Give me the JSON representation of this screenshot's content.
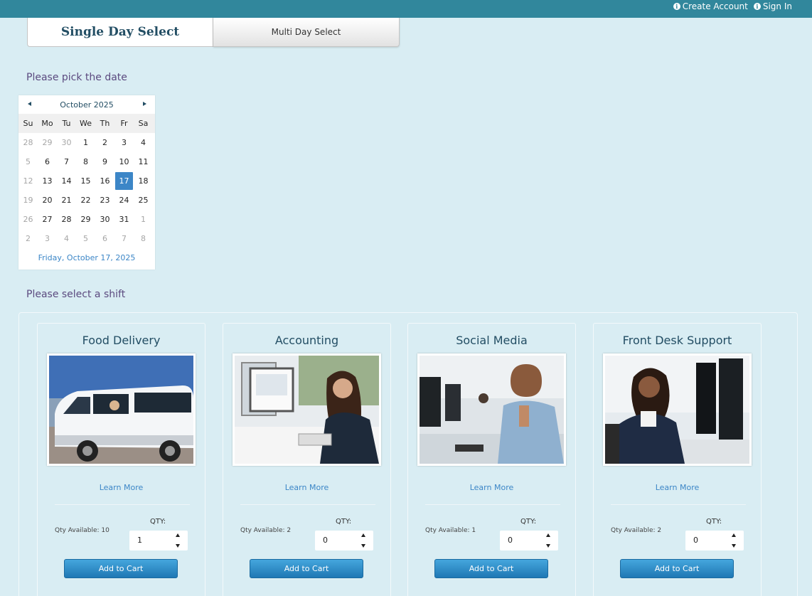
{
  "header": {
    "create_account": "Create Account",
    "sign_in": "Sign In"
  },
  "tabs": {
    "single": "Single Day Select",
    "multi": "Multi Day Select"
  },
  "date_label": "Please pick the date",
  "calendar": {
    "month": "October 2025",
    "dows": [
      "Su",
      "Mo",
      "Tu",
      "We",
      "Th",
      "Fr",
      "Sa"
    ],
    "days": [
      "28",
      "29",
      "30",
      "1",
      "2",
      "3",
      "4",
      "5",
      "6",
      "7",
      "8",
      "9",
      "10",
      "11",
      "12",
      "13",
      "14",
      "15",
      "16",
      "17",
      "18",
      "19",
      "20",
      "21",
      "22",
      "23",
      "24",
      "25",
      "26",
      "27",
      "28",
      "29",
      "30",
      "31",
      "1",
      "2",
      "3",
      "4",
      "5",
      "6",
      "7",
      "8"
    ],
    "muted_indexes": [
      0,
      1,
      2,
      7,
      14,
      21,
      28,
      34,
      35,
      36,
      37,
      38,
      39,
      40,
      41
    ],
    "selected_index": 19,
    "selected_text": "Friday, October 17, 2025"
  },
  "shift_label": "Please select a shift",
  "shifts": [
    {
      "title": "Food Delivery",
      "learn": "Learn More",
      "avail": "Qty Available: 10",
      "qty_label": "QTY:",
      "qty": "1",
      "button": "Add to Cart",
      "image": "van-photo"
    },
    {
      "title": "Accounting",
      "learn": "Learn More",
      "avail": "Qty Available: 2",
      "qty_label": "QTY:",
      "qty": "0",
      "button": "Add to Cart",
      "image": "accountant-photo"
    },
    {
      "title": "Social Media",
      "learn": "Learn More",
      "avail": "Qty Available: 1",
      "qty_label": "QTY:",
      "qty": "0",
      "button": "Add to Cart",
      "image": "call-center-photo"
    },
    {
      "title": "Front Desk Support",
      "learn": "Learn More",
      "avail": "Qty Available: 2",
      "qty_label": "QTY:",
      "qty": "0",
      "button": "Add to Cart",
      "image": "front-desk-photo"
    }
  ],
  "colors": {
    "topbar": "#31879c",
    "page_bg": "#d9edf3",
    "accent": "#3c86c7",
    "title": "#234e64"
  }
}
